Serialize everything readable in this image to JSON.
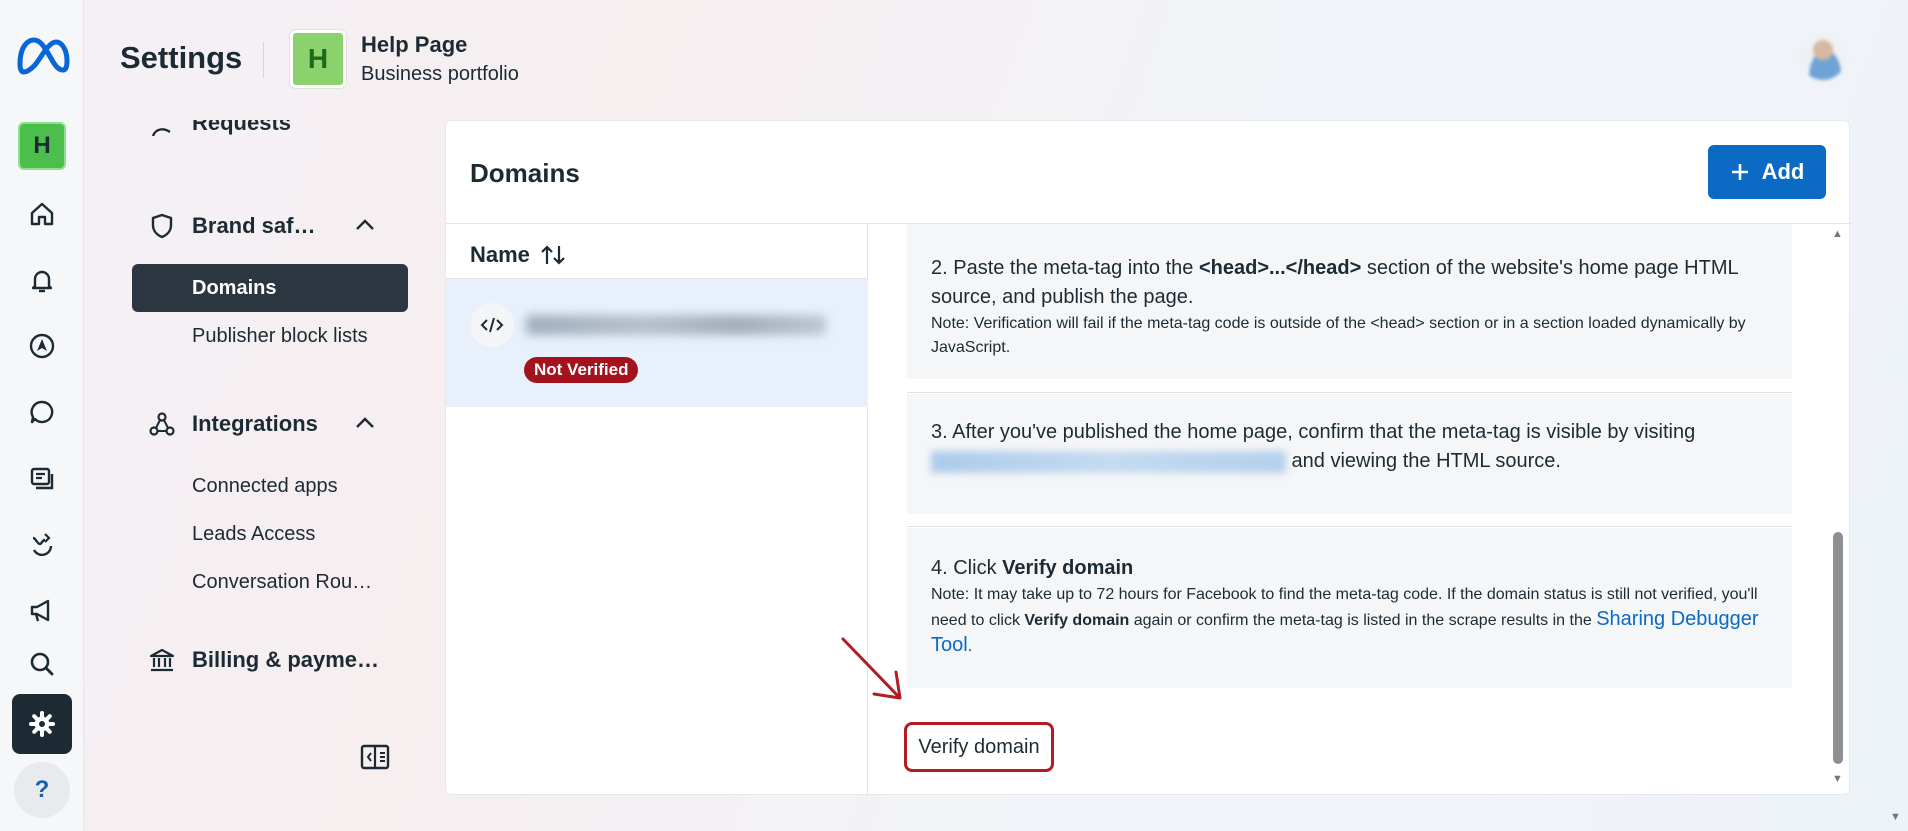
{
  "header": {
    "title": "Settings",
    "business_initial": "H",
    "business_name": "Help Page",
    "business_subtitle": "Business portfolio"
  },
  "rail": {
    "business_initial": "H",
    "help_label": "?"
  },
  "sidenav": {
    "requests_label": "Requests",
    "brand_safety_label": "Brand saf…",
    "domains_label": "Domains",
    "publisher_block_lists_label": "Publisher block lists",
    "integrations_label": "Integrations",
    "connected_apps_label": "Connected apps",
    "leads_access_label": "Leads Access",
    "conversation_routing_label": "Conversation Rou…",
    "billing_label": "Billing & payme…"
  },
  "main": {
    "title": "Domains",
    "add_label": "Add",
    "name_column": "Name",
    "domain_status": "Not Verified"
  },
  "steps": {
    "step2_pre": "2. Paste the meta-tag into the ",
    "step2_bold": "<head>...</head>",
    "step2_post": " section of the website's home page HTML source, and publish the page.",
    "step2_note": "Note: Verification will fail if the meta-tag code is outside of the <head> section or in a section loaded dynamically by JavaScript.",
    "step3_pre": "3. After you've published the home page, confirm that the meta-tag is visible by visiting",
    "step3_post": " and viewing the HTML source.",
    "step4_pre": "4. Click ",
    "step4_bold": "Verify domain",
    "step4_note_pre": "Note: It may take up to 72 hours for Facebook to find the meta-tag code. If the domain status is still not verified, you'll need to click ",
    "step4_note_bold": "Verify domain",
    "step4_note_post": " again or confirm the meta-tag is listed in the scrape results in the ",
    "step4_link": "Sharing Debugger Tool",
    "step4_end": "."
  },
  "verify_button_label": "Verify domain",
  "colors": {
    "accent": "#0a6ac4",
    "status_error": "#a4131d",
    "highlight": "#b01d24"
  }
}
